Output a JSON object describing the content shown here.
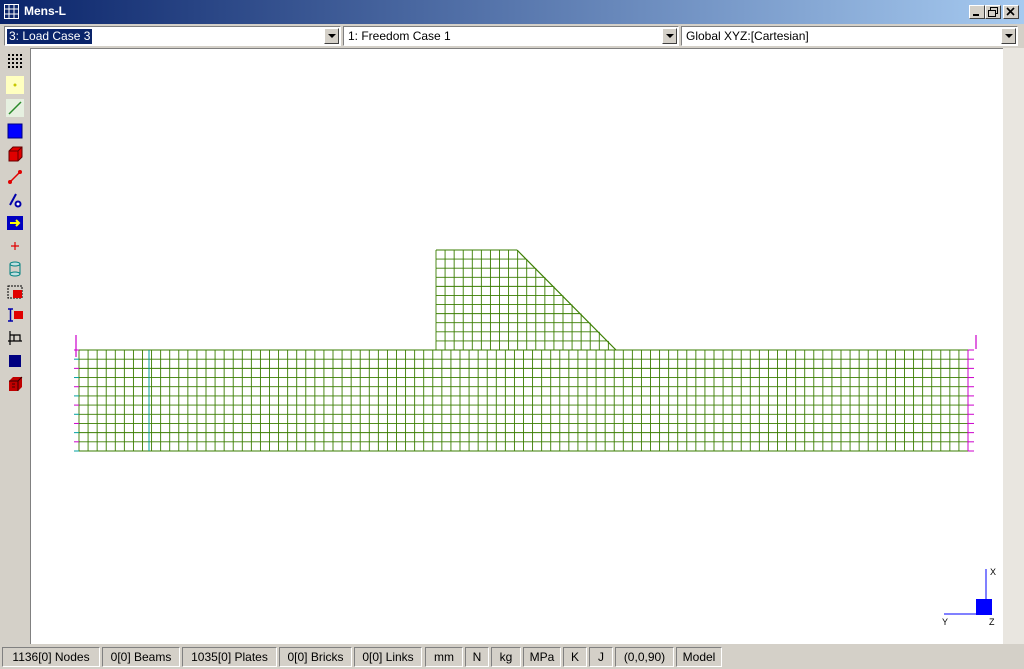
{
  "window": {
    "title": "Mens-L"
  },
  "selectors": {
    "load_case": "3: Load Case 3",
    "freedom_case": "1: Freedom Case 1",
    "coord_system": "Global XYZ:[Cartesian]"
  },
  "toolbar_icons": [
    "grid-dots-icon",
    "node-icon",
    "beam-icon",
    "plate-icon",
    "brick-icon",
    "link-icon",
    "restraint-icon",
    "load-arrow-icon",
    "point-icon",
    "cylinder-icon",
    "plate-properties-icon",
    "beam-properties-icon",
    "measure-icon",
    "fill-icon",
    "solid-box-icon"
  ],
  "axes": {
    "x": "X",
    "y": "Y",
    "z": "Z"
  },
  "status": {
    "nodes": "1136[0] Nodes",
    "beams": "0[0] Beams",
    "plates": "1035[0] Plates",
    "bricks": "0[0] Bricks",
    "links": "0[0] Links",
    "unit_length": "mm",
    "unit_force": "N",
    "unit_mass": "kg",
    "unit_stress": "MPa",
    "unit_temp": "K",
    "unit_energy": "J",
    "view_angle": "(0,0,90)",
    "mode": "Model"
  },
  "colors": {
    "mesh": "#3a7d00",
    "mesh_fill": "#c8c800",
    "edge_marker": "#cc00cc",
    "edge_cyan": "#00a0a0",
    "title_start": "#0a246a",
    "title_end": "#a6caf0"
  }
}
